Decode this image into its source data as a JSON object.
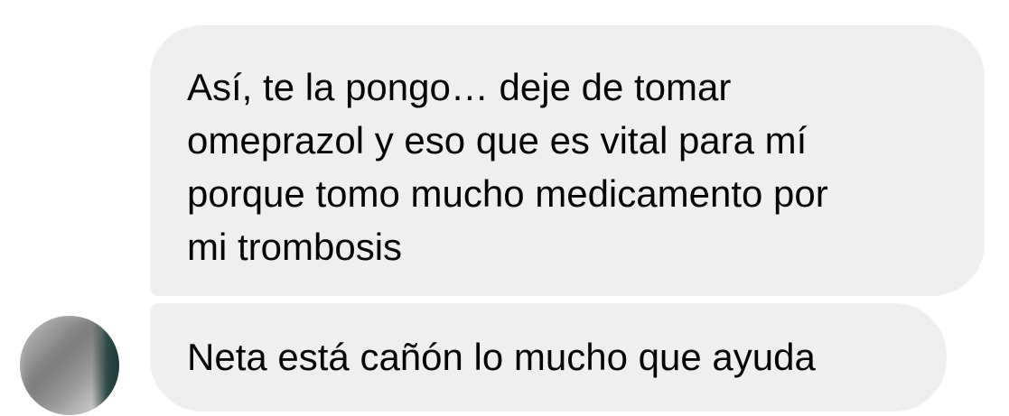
{
  "messages": [
    {
      "text": "Así, te la pongo… deje de tomar\nomeprazol y eso que es vital para mí\nporque tomo mucho medicamento por\nmi trombosis"
    },
    {
      "text": "Neta está cañón lo mucho que ayuda"
    }
  ],
  "colors": {
    "bubble_background": "#efefef",
    "text": "#050505",
    "page_background": "#ffffff"
  }
}
